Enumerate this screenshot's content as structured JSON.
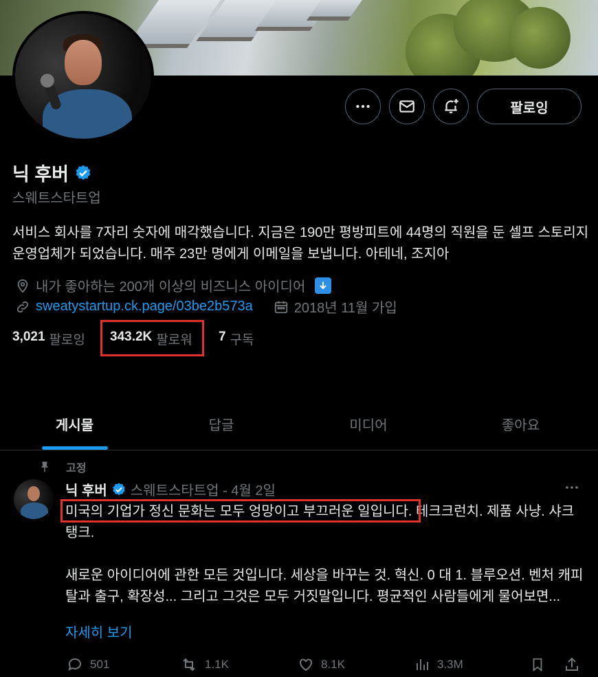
{
  "profile": {
    "name": "닉 후버",
    "handle": "스웨트스타트업",
    "bio": "서비스 회사를 7자리 숫자에 매각했습니다. 지금은 190만 평방피트에 44명의 직원을 둔 셀프 스토리지 운영업체가 되었습니다. 매주 23만 명에게 이메일을 보냅니다. 아테네, 조지아",
    "location": "내가 좋아하는 200개 이상의 비즈니스 아이디어",
    "link": "sweatystartup.ck.page/03be2b573a",
    "joined": "2018년 11월 가입",
    "following_count": "3,021",
    "following_label": "팔로잉",
    "followers_count": "343.2K",
    "followers_label": "팔로워",
    "subs_count": "7",
    "subs_label": "구독"
  },
  "header_buttons": {
    "follow_label": "팔로잉"
  },
  "tabs": [
    {
      "label": "게시물"
    },
    {
      "label": "답글"
    },
    {
      "label": "미디어"
    },
    {
      "label": "좋아요"
    }
  ],
  "post": {
    "pinned_label": "고정",
    "author": "닉 후버",
    "meta": "스웨트스타트업 - 4월 2일",
    "highlight": "미국의 기업가 정신 문화는 모두 엉망이고 부끄러운 일입니다.",
    "line1_rest": " 테크크런치. 제품 사냥. 샤크 탱크.",
    "para2": "새로운 아이디어에 관한 모든 것입니다. 세상을 바꾸는 것. 혁신. 0 대 1. 블루오션. 벤처 캐피탈과 출구, 확장성... 그리고 그것은 모두 거짓말입니다. 평균적인 사람들에게 물어보면...",
    "show_more": "자세히 보기",
    "replies": "501",
    "reposts": "1.1K",
    "likes": "8.1K",
    "views": "3.3M"
  },
  "colors": {
    "accent": "#1d9bf0",
    "highlight_box": "#e0312b",
    "background": "#000000",
    "muted": "#71767b"
  }
}
